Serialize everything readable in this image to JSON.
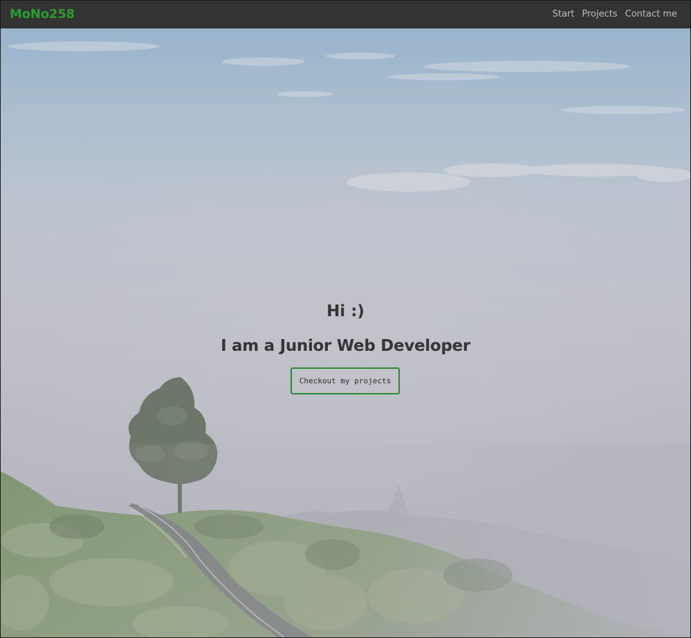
{
  "navbar": {
    "brand": "MoNo258",
    "links": [
      {
        "label": "Start"
      },
      {
        "label": "Projects"
      },
      {
        "label": "Contact me"
      }
    ]
  },
  "hero": {
    "greeting": "Hi :)",
    "tagline": "I am a Junior Web Developer",
    "cta_label": "Checkout my projects",
    "background": "foggy-mountain-road-photo"
  },
  "colors": {
    "navbar_bg": "#333333",
    "brand": "#2a9c2f",
    "nav_link": "#bdbdbd",
    "cta_border": "#2a8a2f",
    "heading": "#353535"
  }
}
